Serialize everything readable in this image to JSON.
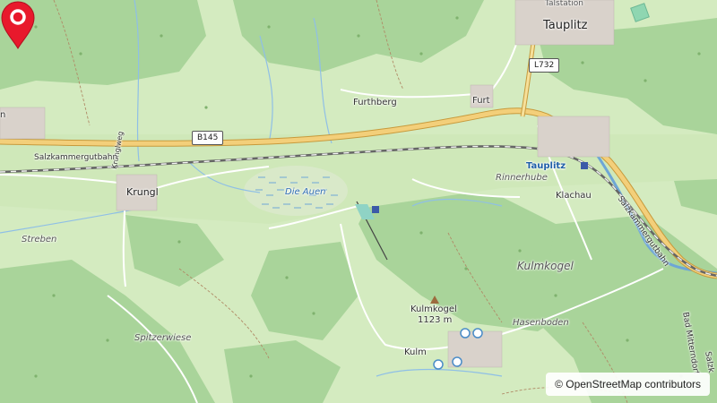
{
  "map": {
    "attribution": "© OpenStreetMap contributors",
    "colors": {
      "meadow": "#d4ebc0",
      "forest": "#a9d49a",
      "road_major": "#f0c674",
      "road_casing": "#c79a3c",
      "marker": "#e8192c",
      "water": "#8fbfe6"
    },
    "labels": {
      "tauplitz_top": "Tauplitz",
      "talstation": "Talstation",
      "furthberg": "Furthberg",
      "furt": "Furt",
      "krungl": "Krungl",
      "krunglweg": "Krunglweg",
      "salzkammergutbahn": "Salzkammergutbahn",
      "salzkammergutbahn_right": "Salzkammergutbahn",
      "die_auen": "Die Auen",
      "tauplitz_station": "Tauplitz",
      "rinnerhube": "Rinnerhube",
      "klachau": "Klachau",
      "streben": "Streben",
      "kulmkogel": "Kulmkogel",
      "kulmkogel_peak": "Kulmkogel",
      "kulmkogel_elev": "1123 m",
      "spitzerwiese": "Spitzerwiese",
      "kulm": "Kulm",
      "hasenboden": "Hasenboden",
      "bad_mitterndorf": "Bad Mitterndorf",
      "salzkammergut_edge": "Salzk",
      "n_edge": "n"
    },
    "shields": {
      "b145": "B145",
      "l732": "L732"
    },
    "icons": [
      "location-marker-icon",
      "peak-icon",
      "tram-stop-icon",
      "swimming-area-icon"
    ]
  }
}
